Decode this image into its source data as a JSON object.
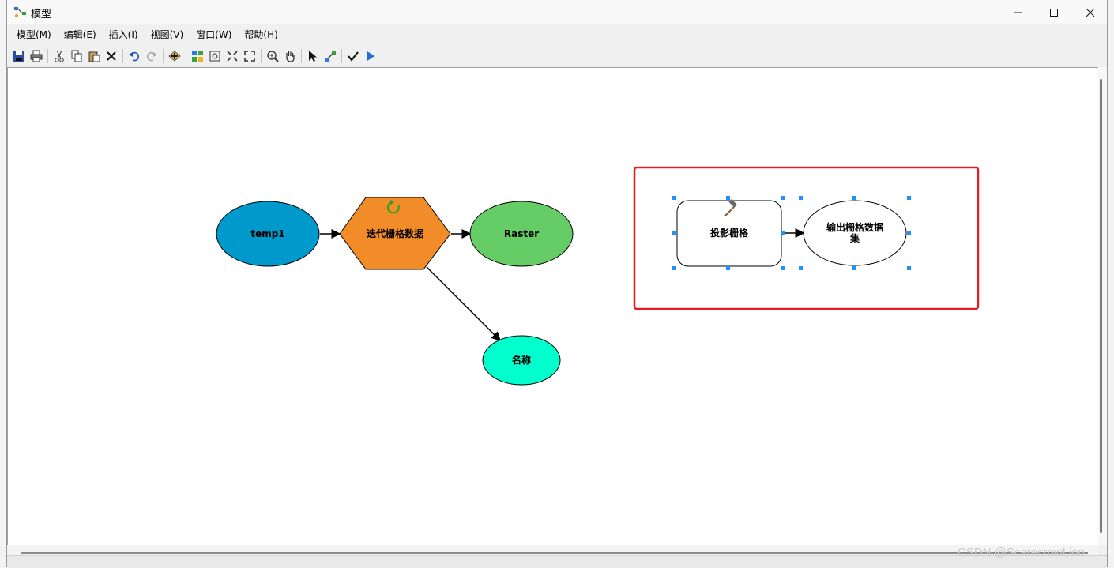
{
  "window": {
    "title": "模型"
  },
  "menu": [
    "模型(M)",
    "编辑(E)",
    "插入(I)",
    "视图(V)",
    "窗口(W)",
    "帮助(H)"
  ],
  "toolbar": {
    "icons": [
      "save-icon",
      "print-icon",
      "cut-icon",
      "copy-icon",
      "paste-icon",
      "delete-icon",
      "undo-icon",
      "redo-icon",
      "add-data-icon",
      "auto-layout-icon",
      "full-extent-icon",
      "zoom-in-fixed-icon",
      "zoom-out-fixed-icon",
      "zoom-in-icon",
      "pan-icon",
      "select-icon",
      "connect-icon",
      "validate-icon",
      "run-icon"
    ]
  },
  "model": {
    "nodes": {
      "input": "temp1",
      "iterator": "迭代栅格数据",
      "raster": "Raster",
      "name": "名称",
      "tool": "投影栅格",
      "output_line1": "输出栅格数据",
      "output_line2": "集"
    },
    "colors": {
      "input": "#0099cc",
      "iterator": "#f28c28",
      "raster": "#66cc66",
      "name": "#00ffcc",
      "highlight": "#e02020",
      "handle": "#1e90ff"
    }
  },
  "watermark": "CSDN @ScarecrowLion"
}
